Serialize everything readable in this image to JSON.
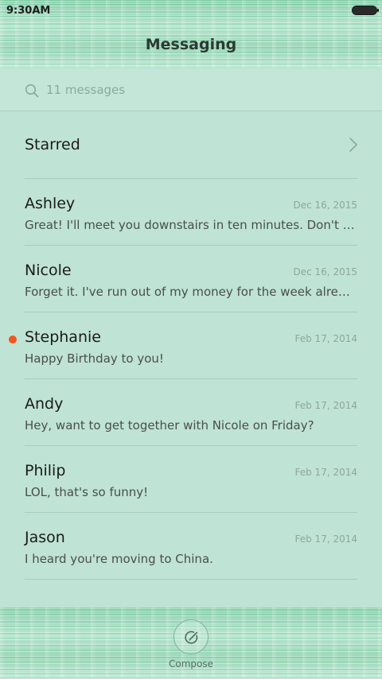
{
  "status_bar": {
    "time": "9:30AM"
  },
  "header": {
    "title": "Messaging"
  },
  "search": {
    "placeholder": "11 messages"
  },
  "starred": {
    "label": "Starred"
  },
  "messages": [
    {
      "name": "Ashley",
      "date": "Dec 16, 2015",
      "preview": "Great! I'll meet you downstairs in ten minutes. Don't forget your umbrella.",
      "unread": false
    },
    {
      "name": "Nicole",
      "date": "Dec 16, 2015",
      "preview": "Forget it. I've run out of my money for the week already.",
      "unread": false
    },
    {
      "name": "Stephanie",
      "date": "Feb 17, 2014",
      "preview": "Happy Birthday to you!",
      "unread": true
    },
    {
      "name": "Andy",
      "date": "Feb 17, 2014",
      "preview": "Hey, want to get together with Nicole on Friday?",
      "unread": false
    },
    {
      "name": "Philip",
      "date": "Feb 17, 2014",
      "preview": "LOL, that's so funny!",
      "unread": false
    },
    {
      "name": "Jason",
      "date": "Feb 17, 2014",
      "preview": "I heard you're moving to China.",
      "unread": false
    }
  ],
  "bottom_bar": {
    "compose_label": "Compose"
  },
  "colors": {
    "background": "#bfe3d4",
    "unread_dot": "#f2551d",
    "title": "#2c3a33",
    "date": "#8fa69c"
  },
  "icons": {
    "search": "search-icon",
    "chevron": "chevron-right-icon",
    "compose": "compose-icon",
    "battery": "battery-icon"
  }
}
